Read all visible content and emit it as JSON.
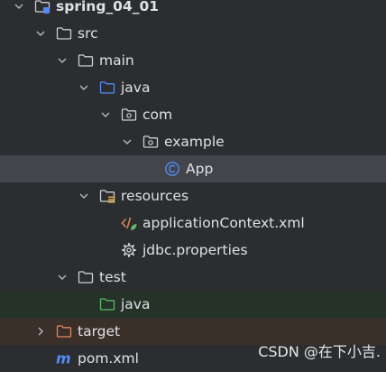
{
  "tree": {
    "root": {
      "label": "spring_04_01",
      "icon": "module-folder-icon",
      "expanded": true
    },
    "src": {
      "label": "src",
      "icon": "folder-icon",
      "expanded": true
    },
    "main": {
      "label": "main",
      "icon": "folder-icon",
      "expanded": true
    },
    "java_main": {
      "label": "java",
      "icon": "source-root-folder-icon",
      "expanded": true
    },
    "com": {
      "label": "com",
      "icon": "package-icon",
      "expanded": true
    },
    "example": {
      "label": "example",
      "icon": "package-icon",
      "expanded": true
    },
    "app": {
      "label": "App",
      "icon": "java-class-icon",
      "selected": true
    },
    "resources": {
      "label": "resources",
      "icon": "resources-root-folder-icon",
      "expanded": true
    },
    "app_context": {
      "label": "applicationContext.xml",
      "icon": "xml-file-icon"
    },
    "jdbc": {
      "label": "jdbc.properties",
      "icon": "properties-gear-icon"
    },
    "test": {
      "label": "test",
      "icon": "folder-icon",
      "expanded": true
    },
    "java_test": {
      "label": "java",
      "icon": "test-root-folder-icon"
    },
    "target": {
      "label": "target",
      "icon": "excluded-folder-icon",
      "expanded": false
    },
    "pom": {
      "label": "pom.xml",
      "icon": "maven-icon"
    }
  },
  "colors": {
    "background": "#2b2d30",
    "selected_row": "#43454a",
    "test_row": "#253228",
    "excluded_row": "#3b2f2a",
    "source_root": "#548af7",
    "test_root": "#5fb865",
    "excluded": "#e08855",
    "text": "#dfe1e5"
  },
  "watermark": "CSDN @在下小吉."
}
